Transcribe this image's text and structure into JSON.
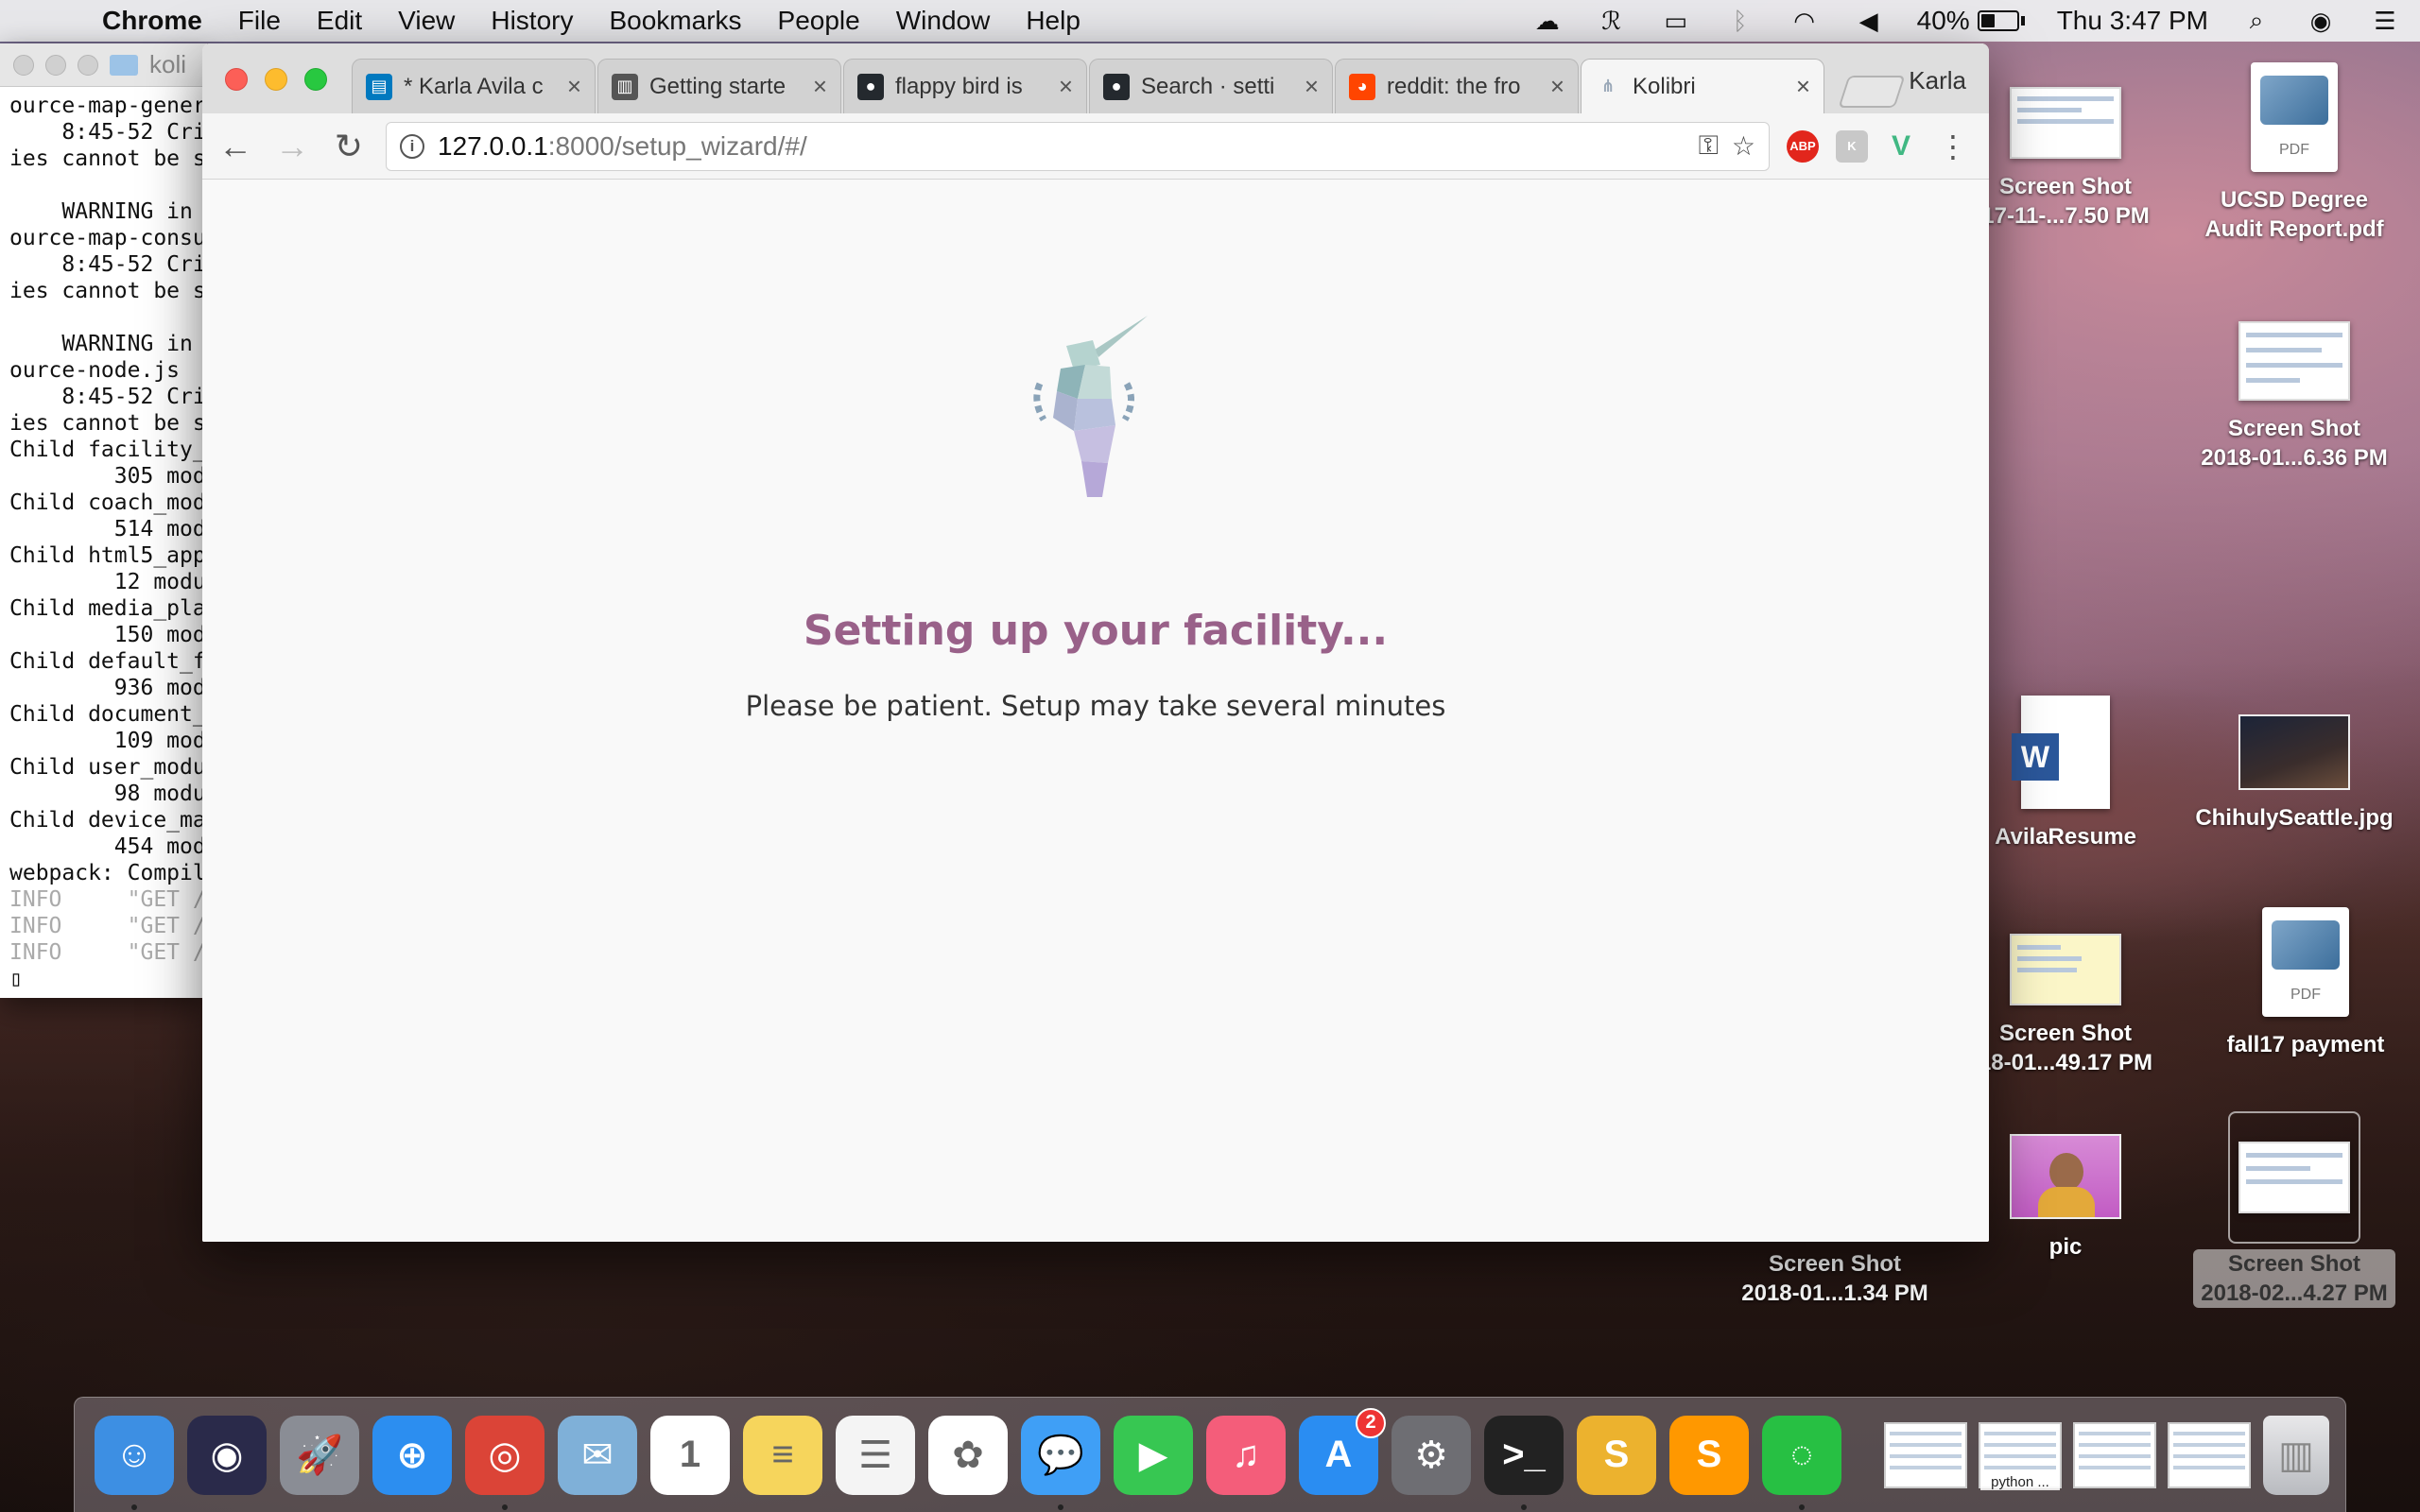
{
  "menubar": {
    "app_name": "Chrome",
    "items": [
      "File",
      "Edit",
      "View",
      "History",
      "Bookmarks",
      "People",
      "Window",
      "Help"
    ],
    "battery_percent": "40%",
    "battery_level": 0.4,
    "clock": "Thu 3:47 PM",
    "status_icons": [
      "creative-cloud-icon",
      "app-icon",
      "airplay-icon",
      "bluetooth-icon",
      "wifi-icon",
      "volume-icon",
      "battery-icon",
      "spotlight-icon",
      "siri-icon",
      "notification-center-icon"
    ]
  },
  "terminal": {
    "title": "koli",
    "lines": [
      {
        "text": "ource-map-gener",
        "dim": false
      },
      {
        "text": "    8:45-52 Cri",
        "dim": false
      },
      {
        "text": "ies cannot be s",
        "dim": false
      },
      {
        "text": "",
        "dim": false
      },
      {
        "text": "    WARNING in ",
        "dim": false
      },
      {
        "text": "ource-map-consu",
        "dim": false
      },
      {
        "text": "    8:45-52 Cri",
        "dim": false
      },
      {
        "text": "ies cannot be s",
        "dim": false
      },
      {
        "text": "",
        "dim": false
      },
      {
        "text": "    WARNING in ",
        "dim": false
      },
      {
        "text": "ource-node.js",
        "dim": false
      },
      {
        "text": "    8:45-52 Cri",
        "dim": false
      },
      {
        "text": "ies cannot be s",
        "dim": false
      },
      {
        "text": "Child facility_",
        "dim": false
      },
      {
        "text": "        305 modu",
        "dim": false
      },
      {
        "text": "Child coach_mod",
        "dim": false
      },
      {
        "text": "        514 modu",
        "dim": false
      },
      {
        "text": "Child html5_app",
        "dim": false
      },
      {
        "text": "        12 modul",
        "dim": false
      },
      {
        "text": "Child media_pla",
        "dim": false
      },
      {
        "text": "        150 modu",
        "dim": false
      },
      {
        "text": "Child default_f",
        "dim": false
      },
      {
        "text": "        936 modu",
        "dim": false
      },
      {
        "text": "Child document_",
        "dim": false
      },
      {
        "text": "        109 modu",
        "dim": false
      },
      {
        "text": "Child user_modu",
        "dim": false
      },
      {
        "text": "        98 modul",
        "dim": false
      },
      {
        "text": "Child device_ma",
        "dim": false
      },
      {
        "text": "        454 modu",
        "dim": false
      },
      {
        "text": "webpack: Compil",
        "dim": false
      },
      {
        "text": "INFO     \"GET /",
        "dim": true
      },
      {
        "text": "INFO     \"GET /",
        "dim": true
      },
      {
        "text": "INFO     \"GET /",
        "dim": true
      },
      {
        "text": "▯",
        "dim": false
      }
    ]
  },
  "browser": {
    "tabs": [
      {
        "title": "* Karla Avila c",
        "icon": "trello-icon",
        "color": "#0079bf",
        "active": false
      },
      {
        "title": "Getting starte",
        "icon": "docs-icon",
        "color": "#555555",
        "active": false
      },
      {
        "title": "flappy bird is",
        "icon": "github-icon",
        "color": "#24292e",
        "active": false
      },
      {
        "title": "Search · setti",
        "icon": "github-icon",
        "color": "#24292e",
        "active": false
      },
      {
        "title": "reddit: the fro",
        "icon": "reddit-icon",
        "color": "#ff4500",
        "active": false
      },
      {
        "title": "Kolibri",
        "icon": "kolibri-icon",
        "color": "#9aa8b8",
        "active": true
      }
    ],
    "profile_name": "Karla",
    "url_host": "127.0.0.1",
    "url_rest": ":8000/setup_wizard/#/",
    "extensions": [
      {
        "name": "adblock-plus-icon",
        "label": "ABP",
        "color": "#e2261c"
      },
      {
        "name": "kolibri-ext-icon",
        "label": "K",
        "color": "#c8c8c8"
      },
      {
        "name": "vue-devtools-icon",
        "label": "V",
        "color": "#41b883"
      }
    ]
  },
  "page": {
    "title": "Setting up your facility...",
    "subtitle": "Please be patient. Setup may take several minutes",
    "accent_color": "#996189"
  },
  "desktop": {
    "icons": [
      {
        "label": "Screen Shot\n17-11-...7.50 PM",
        "kind": "shot"
      },
      {
        "label": "UCSD Degree\nAudit Report.pdf",
        "kind": "pdf"
      },
      {
        "label": "Screen Shot\n2018-01...6.36 PM",
        "kind": "shot"
      },
      {
        "label": "AvilaResume",
        "kind": "doc"
      },
      {
        "label": "ChihulySeattle.jpg",
        "kind": "photo"
      },
      {
        "label": "Screen Shot\n18-01...49.17 PM",
        "kind": "shot"
      },
      {
        "label": "fall17 payment",
        "kind": "pdf"
      },
      {
        "label": "pic",
        "kind": "pic"
      },
      {
        "label": "Screen Shot\n2018-01...1.34 PM",
        "kind": "none"
      },
      {
        "label": "Screen Shot\n2018-02...4.27 PM",
        "kind": "shot-selected"
      }
    ]
  },
  "dock": {
    "apps": [
      {
        "name": "finder-icon",
        "glyph": "☺",
        "color": "#3d8fe3",
        "running": true
      },
      {
        "name": "siri-icon",
        "glyph": "◉",
        "color": "#2a2a4a",
        "running": false
      },
      {
        "name": "launchpad-icon",
        "glyph": "🚀",
        "color": "#8a8d95",
        "running": false
      },
      {
        "name": "safari-icon",
        "glyph": "⊕",
        "color": "#2c8ef0",
        "running": false
      },
      {
        "name": "chrome-icon",
        "glyph": "◎",
        "color": "#db4437",
        "running": true
      },
      {
        "name": "mail-icon",
        "glyph": "✉",
        "color": "#7fb0d8",
        "running": false
      },
      {
        "name": "calendar-icon",
        "glyph": "1",
        "color": "#ffffff",
        "running": false
      },
      {
        "name": "notes-icon",
        "glyph": "≡",
        "color": "#f6d55c",
        "running": false
      },
      {
        "name": "reminders-icon",
        "glyph": "☰",
        "color": "#f4f4f4",
        "running": false
      },
      {
        "name": "photos-icon",
        "glyph": "✿",
        "color": "#ffffff",
        "running": false
      },
      {
        "name": "messages-icon",
        "glyph": "💬",
        "color": "#3f9ff6",
        "running": true
      },
      {
        "name": "facetime-icon",
        "glyph": "▶",
        "color": "#37c752",
        "running": false
      },
      {
        "name": "itunes-icon",
        "glyph": "♫",
        "color": "#f45d7a",
        "running": false
      },
      {
        "name": "app-store-icon",
        "glyph": "A",
        "color": "#2a8df2",
        "running": false,
        "badge": "2"
      },
      {
        "name": "system-preferences-icon",
        "glyph": "⚙",
        "color": "#6e6e73",
        "running": false
      },
      {
        "name": "terminal-icon",
        "glyph": ">_",
        "color": "#222222",
        "running": true
      },
      {
        "name": "slack-icon",
        "glyph": "S",
        "color": "#ecb22e",
        "running": false
      },
      {
        "name": "sublime-text-icon",
        "glyph": "S",
        "color": "#ff9800",
        "running": false
      },
      {
        "name": "progress-ring-icon",
        "glyph": "◌",
        "color": "#27c043",
        "running": true
      }
    ],
    "minimized": [
      {
        "name": "minimized-window-1",
        "label": ""
      },
      {
        "name": "minimized-window-2",
        "label": "python ..."
      },
      {
        "name": "minimized-window-3",
        "label": ""
      },
      {
        "name": "minimized-window-4",
        "label": ""
      }
    ],
    "trash": "trash-icon"
  }
}
